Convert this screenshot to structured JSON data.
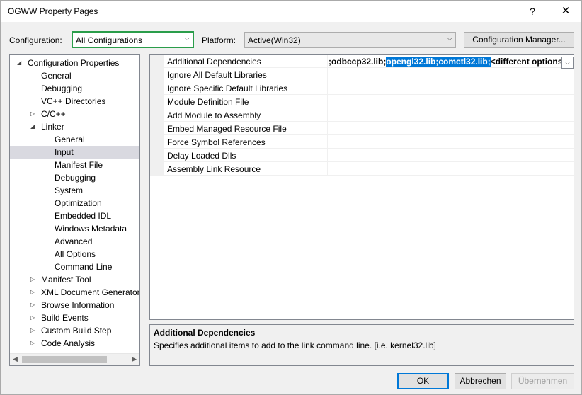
{
  "window": {
    "title": "OGWW Property Pages"
  },
  "controls": {
    "help_glyph": "?",
    "close_glyph": "✕",
    "chevron_glyph": "⌵"
  },
  "config": {
    "configuration_label": "Configuration:",
    "configuration_value": "All Configurations",
    "platform_label": "Platform:",
    "platform_value": "Active(Win32)",
    "manager_button": "Configuration Manager..."
  },
  "tree": {
    "items": [
      {
        "label": "Configuration Properties",
        "arrow": "◢"
      },
      {
        "label": "General"
      },
      {
        "label": "Debugging"
      },
      {
        "label": "VC++ Directories"
      },
      {
        "label": "C/C++",
        "arrow": "▷"
      },
      {
        "label": "Linker",
        "arrow": "◢"
      },
      {
        "label": "General"
      },
      {
        "label": "Input"
      },
      {
        "label": "Manifest File"
      },
      {
        "label": "Debugging"
      },
      {
        "label": "System"
      },
      {
        "label": "Optimization"
      },
      {
        "label": "Embedded IDL"
      },
      {
        "label": "Windows Metadata"
      },
      {
        "label": "Advanced"
      },
      {
        "label": "All Options"
      },
      {
        "label": "Command Line"
      },
      {
        "label": "Manifest Tool",
        "arrow": "▷"
      },
      {
        "label": "XML Document Generator",
        "arrow": "▷"
      },
      {
        "label": "Browse Information",
        "arrow": "▷"
      },
      {
        "label": "Build Events",
        "arrow": "▷"
      },
      {
        "label": "Custom Build Step",
        "arrow": "▷"
      },
      {
        "label": "Code Analysis",
        "arrow": "▷"
      }
    ],
    "scroll_left": "◀",
    "scroll_right": "▶"
  },
  "grid": {
    "rows": [
      {
        "name": "Additional Dependencies"
      },
      {
        "name": "Ignore All Default Libraries"
      },
      {
        "name": "Ignore Specific Default Libraries"
      },
      {
        "name": "Module Definition File"
      },
      {
        "name": "Add Module to Assembly"
      },
      {
        "name": "Embed Managed Resource File"
      },
      {
        "name": "Force Symbol References"
      },
      {
        "name": "Delay Loaded Dlls"
      },
      {
        "name": "Assembly Link Resource"
      }
    ],
    "value_prefix": ";odbccp32.lib;",
    "value_selected": "opengl32.lib;comctl32.lib;",
    "value_suffix": "<different options>",
    "dropdown_glyph": "⌵"
  },
  "description": {
    "title": "Additional Dependencies",
    "text": "Specifies additional items to add to the link command line. [i.e. kernel32.lib]"
  },
  "buttons": {
    "ok": "OK",
    "cancel": "Abbrechen",
    "apply": "Übernehmen"
  },
  "colors": {
    "focus_border": "#2a9d4a",
    "selection": "#0078d7",
    "tree_selected": "#d9d9e0"
  }
}
